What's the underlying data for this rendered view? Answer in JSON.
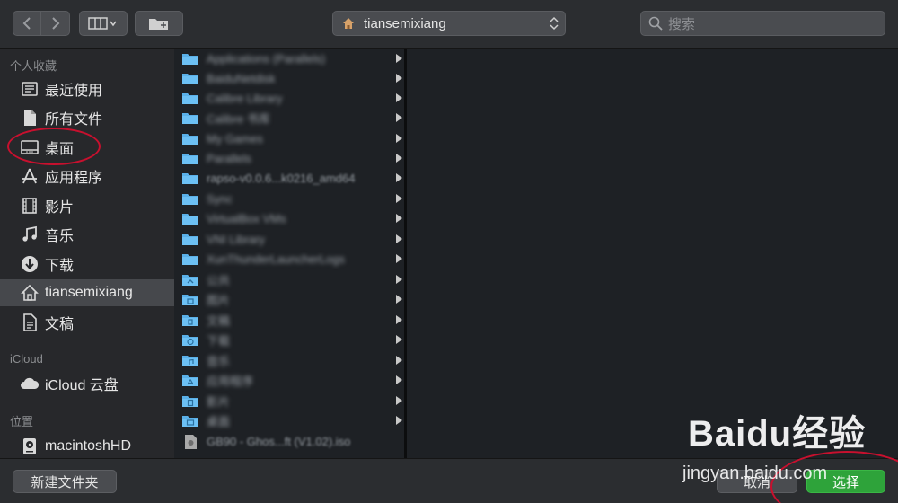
{
  "toolbar": {
    "location": "tiansemixiang",
    "search_placeholder": "搜索"
  },
  "sidebar": {
    "favorites_title": "个人收藏",
    "favorites": [
      {
        "label": "最近使用",
        "icon": "recents-icon"
      },
      {
        "label": "所有文件",
        "icon": "document-icon"
      },
      {
        "label": "桌面",
        "icon": "desktop-icon"
      },
      {
        "label": "应用程序",
        "icon": "applications-icon"
      },
      {
        "label": "影片",
        "icon": "movies-icon"
      },
      {
        "label": "音乐",
        "icon": "music-icon"
      },
      {
        "label": "下载",
        "icon": "downloads-icon"
      },
      {
        "label": "tiansemixiang",
        "icon": "home-icon"
      },
      {
        "label": "文稿",
        "icon": "documents-icon"
      }
    ],
    "icloud_title": "iCloud",
    "icloud_items": [
      {
        "label": "iCloud 云盘",
        "icon": "cloud-icon"
      }
    ],
    "locations_title": "位置",
    "location_items": [
      {
        "label": "macintoshHD",
        "icon": "disk-icon"
      }
    ]
  },
  "files": [
    {
      "name": "Applications (Parallels)",
      "arrow": true
    },
    {
      "name": "BaiduNetdisk",
      "arrow": true
    },
    {
      "name": "Calibre Library",
      "arrow": true
    },
    {
      "name": "Calibre 书库",
      "arrow": true
    },
    {
      "name": "My Games",
      "arrow": true
    },
    {
      "name": "Parallels",
      "arrow": true
    },
    {
      "name": "rapso-v0.0.6...k0216_amd64",
      "arrow": true
    },
    {
      "name": "Sync",
      "arrow": true
    },
    {
      "name": "VirtualBox VMs",
      "arrow": true
    },
    {
      "name": "VNI Library",
      "arrow": true
    },
    {
      "name": "XunThunderLauncherLogs",
      "arrow": true
    },
    {
      "name": "公共",
      "arrow": true
    },
    {
      "name": "图片",
      "arrow": true
    },
    {
      "name": "文稿",
      "arrow": true
    },
    {
      "name": "下载",
      "arrow": true
    },
    {
      "name": "音乐",
      "arrow": true
    },
    {
      "name": "应用程序",
      "arrow": true
    },
    {
      "name": "影片",
      "arrow": true
    },
    {
      "name": "桌面",
      "arrow": true
    },
    {
      "name": "GB90 - Ghos...ft (V1.02).iso",
      "arrow": false
    }
  ],
  "bottom": {
    "new_folder": "新建文件夹",
    "cancel": "取消",
    "choose": "选择"
  },
  "watermark": {
    "logo": "Baidu经验",
    "url": "jingyan.baidu.com"
  },
  "colors": {
    "accent_choose": "#2ea33a",
    "annotation": "#c8102e",
    "folder": "#5ab0e8"
  }
}
